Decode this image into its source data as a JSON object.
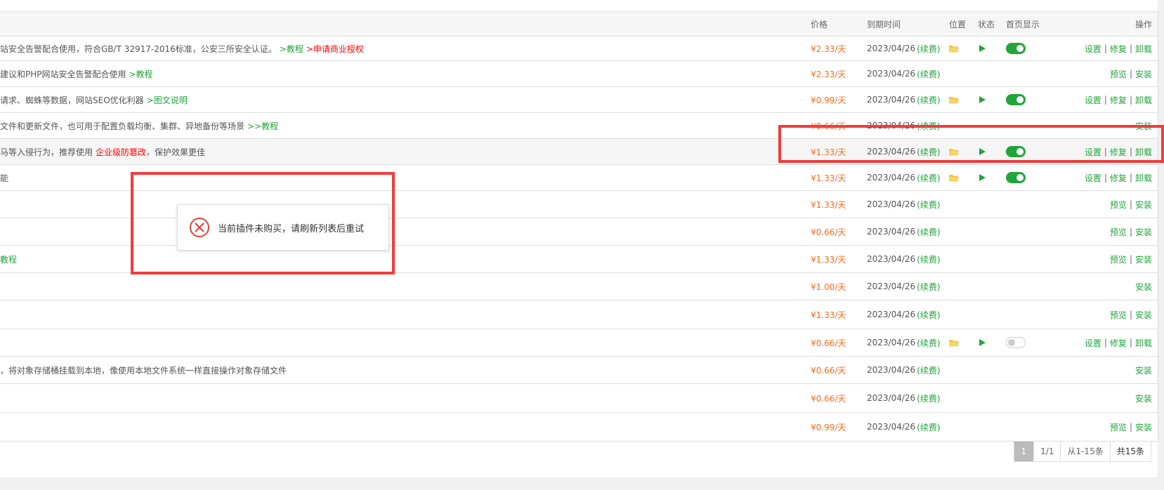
{
  "header": {
    "price": "价格",
    "expire": "到期时间",
    "location": "位置",
    "status": "状态",
    "home_display": "首页显示",
    "operations": "操作"
  },
  "rows": [
    {
      "desc": "站安全告警配合使用，符合GB/T 32917-2016标准，公安三所安全认证。",
      "links": [
        {
          "text": ">教程",
          "color": "green"
        },
        {
          "text": ">申请商业授权",
          "color": "red"
        }
      ],
      "price": "¥2.33/天",
      "expire": "2023/04/26",
      "renew": "(续费)",
      "folder": true,
      "play": true,
      "toggle": "on",
      "ops": [
        "设置",
        "修复",
        "卸载"
      ]
    },
    {
      "desc": "建议和PHP网站安全告警配合使用",
      "links": [
        {
          "text": ">教程",
          "color": "green"
        }
      ],
      "price": "¥2.33/天",
      "expire": "2023/04/26",
      "renew": "(续费)",
      "folder": false,
      "play": false,
      "toggle": "",
      "ops": [
        "预览",
        "安装"
      ]
    },
    {
      "desc": "请求、蜘蛛等数据，网站SEO优化利器",
      "links": [
        {
          "text": ">图文说明",
          "color": "green"
        }
      ],
      "price": "¥0.99/天",
      "expire": "2023/04/26",
      "renew": "(续费)",
      "folder": true,
      "play": true,
      "toggle": "on",
      "ops": [
        "设置",
        "修复",
        "卸载"
      ]
    },
    {
      "desc": "文件和更新文件，也可用于配置负载均衡、集群、异地备份等场景",
      "links": [
        {
          "text": ">>教程",
          "color": "green"
        }
      ],
      "price": "¥0.66/天",
      "expire": "2023/04/26",
      "renew": "(续费)",
      "folder": false,
      "play": false,
      "toggle": "",
      "ops": [
        "安装"
      ]
    },
    {
      "desc": "马等入侵行为，推荐使用",
      "links": [
        {
          "text": "企业级防篡改",
          "color": "red"
        }
      ],
      "desc_after": "，保护效果更佳",
      "price": "¥1.33/天",
      "expire": "2023/04/26",
      "renew": "(续费)",
      "folder": true,
      "play": true,
      "toggle": "on",
      "ops": [
        "设置",
        "修复",
        "卸载"
      ],
      "highlight": true
    },
    {
      "desc": "能",
      "links": [],
      "price": "¥1.33/天",
      "expire": "2023/04/26",
      "renew": "(续费)",
      "folder": true,
      "play": true,
      "toggle": "on",
      "ops": [
        "设置",
        "修复",
        "卸载"
      ]
    },
    {
      "desc": "",
      "links": [],
      "price": "¥1.33/天",
      "expire": "2023/04/26",
      "renew": "(续费)",
      "folder": false,
      "play": false,
      "toggle": "",
      "ops": [
        "预览",
        "安装"
      ]
    },
    {
      "desc": "",
      "links": [],
      "price": "¥0.66/天",
      "expire": "2023/04/26",
      "renew": "(续费)",
      "folder": false,
      "play": false,
      "toggle": "",
      "ops": [
        "预览",
        "安装"
      ]
    },
    {
      "desc": "",
      "links": [
        {
          "text": "教程",
          "color": "green"
        }
      ],
      "price": "¥1.33/天",
      "expire": "2023/04/26",
      "renew": "(续费)",
      "folder": false,
      "play": false,
      "toggle": "",
      "ops": [
        "预览",
        "安装"
      ]
    },
    {
      "desc": "",
      "links": [],
      "price": "¥1.00/天",
      "expire": "2023/04/26",
      "renew": "(续费)",
      "folder": false,
      "play": false,
      "toggle": "",
      "ops": [
        "安装"
      ]
    },
    {
      "desc": "",
      "links": [],
      "price": "¥1.33/天",
      "expire": "2023/04/26",
      "renew": "(续费)",
      "folder": false,
      "play": false,
      "toggle": "",
      "ops": [
        "预览",
        "安装"
      ]
    },
    {
      "desc": "",
      "links": [],
      "price": "¥0.66/天",
      "expire": "2023/04/26",
      "renew": "(续费)",
      "folder": true,
      "play": true,
      "toggle": "off",
      "ops": [
        "设置",
        "修复",
        "卸载"
      ]
    },
    {
      "desc": "，将对象存储桶挂载到本地，像使用本地文件系统一样直接操作对象存储文件",
      "links": [],
      "price": "¥0.66/天",
      "expire": "2023/04/26",
      "renew": "(续费)",
      "folder": false,
      "play": false,
      "toggle": "",
      "ops": [
        "安装"
      ]
    },
    {
      "desc": "",
      "links": [],
      "price": "¥0.66/天",
      "expire": "2023/04/26",
      "renew": "(续费)",
      "folder": false,
      "play": false,
      "toggle": "",
      "ops": [
        "安装"
      ]
    },
    {
      "desc": "",
      "links": [],
      "price": "¥0.99/天",
      "expire": "2023/04/26",
      "renew": "(续费)",
      "folder": false,
      "play": false,
      "toggle": "",
      "ops": [
        "预览",
        "安装"
      ]
    }
  ],
  "pagination": {
    "current": "1",
    "pages": "1/1",
    "range": "从1-15条",
    "total": "共15条"
  },
  "toast": {
    "message": "当前插件未购买，请刷新列表后重试"
  },
  "colors": {
    "price": "#ff6a1a",
    "green": "#20a53a",
    "red": "#ff0000",
    "highlight_box": "#f03c3c"
  }
}
